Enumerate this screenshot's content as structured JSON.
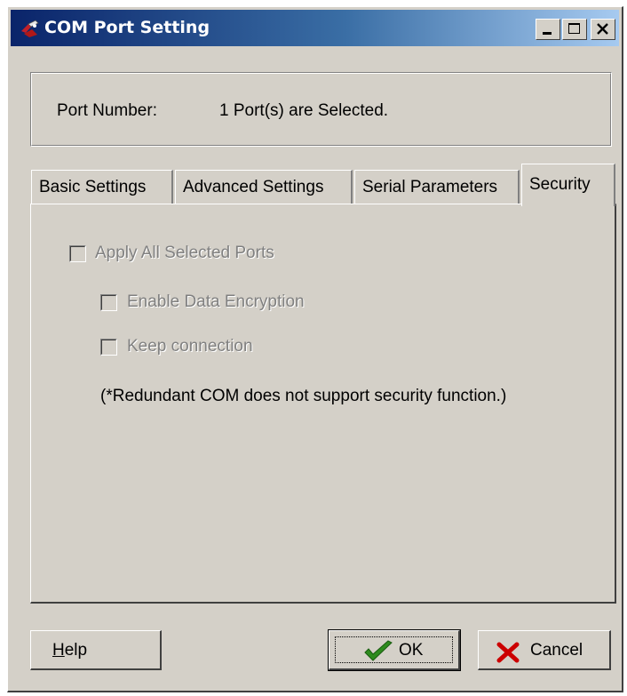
{
  "window": {
    "title": "COM Port Setting",
    "controls": [
      "minimize",
      "maximize",
      "close"
    ]
  },
  "port_info": {
    "label": "Port Number:",
    "value": "1 Port(s) are Selected."
  },
  "tabs": [
    {
      "label": "Basic Settings",
      "active": false
    },
    {
      "label": "Advanced Settings",
      "active": false
    },
    {
      "label": "Serial Parameters",
      "active": false
    },
    {
      "label": "Security",
      "active": true
    }
  ],
  "security": {
    "apply_all_label": "Apply All Selected Ports",
    "enable_encryption_label": "Enable Data Encryption",
    "keep_connection_label": "Keep connection",
    "note": "(*Redundant COM does not support security function.)"
  },
  "buttons": {
    "help_mnemonic": "H",
    "help_rest": "elp",
    "ok_label": "OK",
    "cancel_label": "Cancel"
  },
  "colors": {
    "titlebar_start": "#0a246a",
    "titlebar_end": "#a6caf0",
    "face": "#d4d0c8",
    "disabled_text": "#808080",
    "ok_check": "#2e8b1e",
    "cancel_x": "#cc0000"
  },
  "icons": {
    "app": "com-port-icon",
    "ok": "checkmark-icon",
    "cancel": "red-x-icon"
  }
}
